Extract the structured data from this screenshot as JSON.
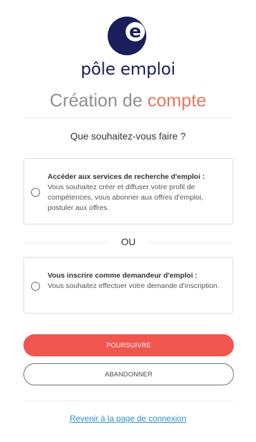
{
  "brand": {
    "logo_icon": "pole-emploi-e-logo",
    "logo_letter": "e",
    "name": "pôle emploi",
    "navy": "#1a1e5a",
    "accent": "#f0564f"
  },
  "title": {
    "part1": "Création de",
    "part2": "compte"
  },
  "question": "Que souhaitez-vous faire ?",
  "options": [
    {
      "title": "Accéder aux services de recherche d'emploi :",
      "description": "Vous souhaitez créer et diffuser votre profil de compétences, vous abonner aux offres d'emploi, postuler aux offres.",
      "selected": false
    },
    {
      "title": "Vous inscrire comme demandeur d'emploi :",
      "description": "Vous souhaitez effectuer votre demande d'inscription.",
      "selected": false
    }
  ],
  "separator": "OU",
  "buttons": {
    "continue": "POURSUIVRE",
    "abandon": "ABANDONNER"
  },
  "login_link": "Revenir à la page de connexion"
}
